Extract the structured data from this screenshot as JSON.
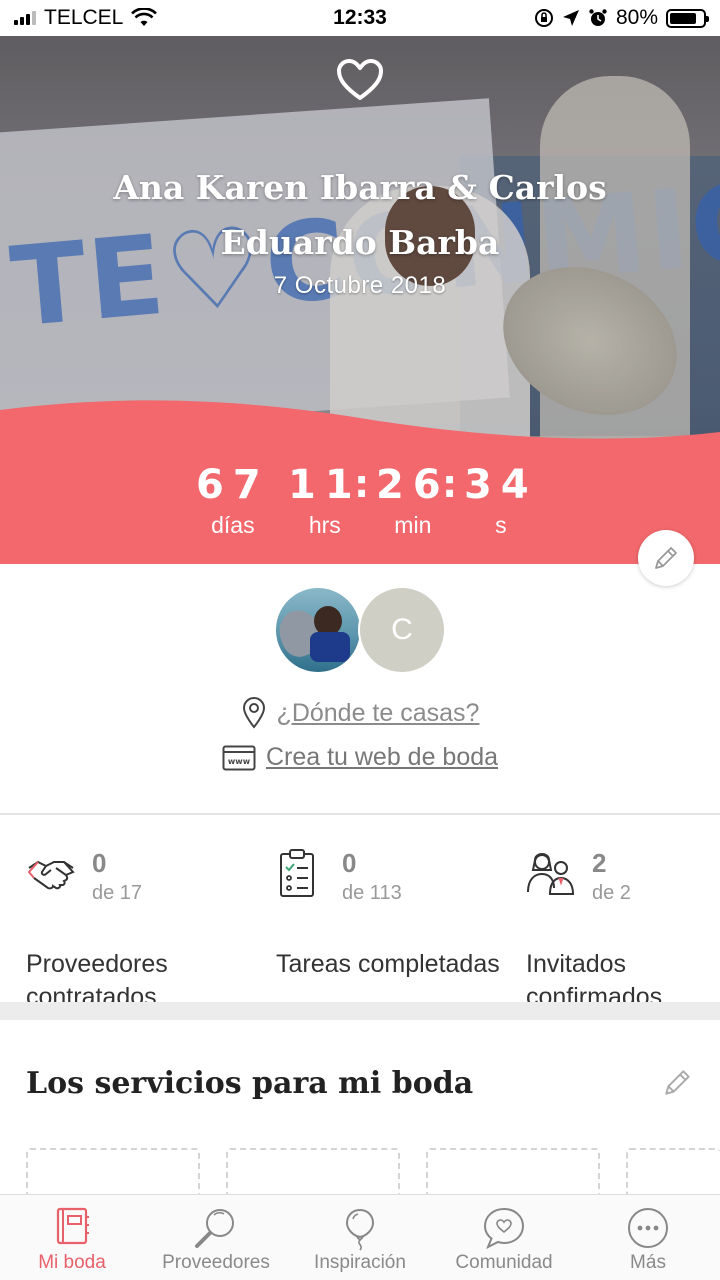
{
  "status_bar": {
    "carrier": "TELCEL",
    "time": "12:33",
    "battery": "80%",
    "battery_level": 0.8
  },
  "hero": {
    "couple_name": "Ana Karen Ibarra & Carlos Eduardo Barba",
    "wedding_date": "7 Octubre 2018",
    "banner_text": "TE♡CONMIGO"
  },
  "countdown": {
    "days": "67",
    "days_label": "días",
    "hours": "11",
    "hours_label": "hrs",
    "minutes": "26",
    "minutes_label": "min",
    "seconds": "34",
    "seconds_label": "s"
  },
  "profile": {
    "partner_initial": "C",
    "where_link": "¿Dónde te casas?",
    "web_link": "Crea tu web de boda"
  },
  "stats": [
    {
      "icon": "handshake-icon",
      "count": "0",
      "of": "de 17",
      "label": "Proveedores contratados"
    },
    {
      "icon": "checklist-icon",
      "count": "0",
      "of": "de 113",
      "label": "Tareas completadas"
    },
    {
      "icon": "guests-icon",
      "count": "2",
      "of": "de 2",
      "label": "Invitados confirmados"
    }
  ],
  "services": {
    "title": "Los servicios para mi boda"
  },
  "tabs": [
    {
      "label": "Mi boda",
      "icon": "notebook-icon",
      "active": true
    },
    {
      "label": "Proveedores",
      "icon": "search-icon",
      "active": false
    },
    {
      "label": "Inspiración",
      "icon": "balloon-icon",
      "active": false
    },
    {
      "label": "Comunidad",
      "icon": "chat-heart-icon",
      "active": false
    },
    {
      "label": "Más",
      "icon": "more-icon",
      "active": false
    }
  ],
  "colors": {
    "accent": "#f2686c",
    "tab_active": "#e8616a"
  }
}
